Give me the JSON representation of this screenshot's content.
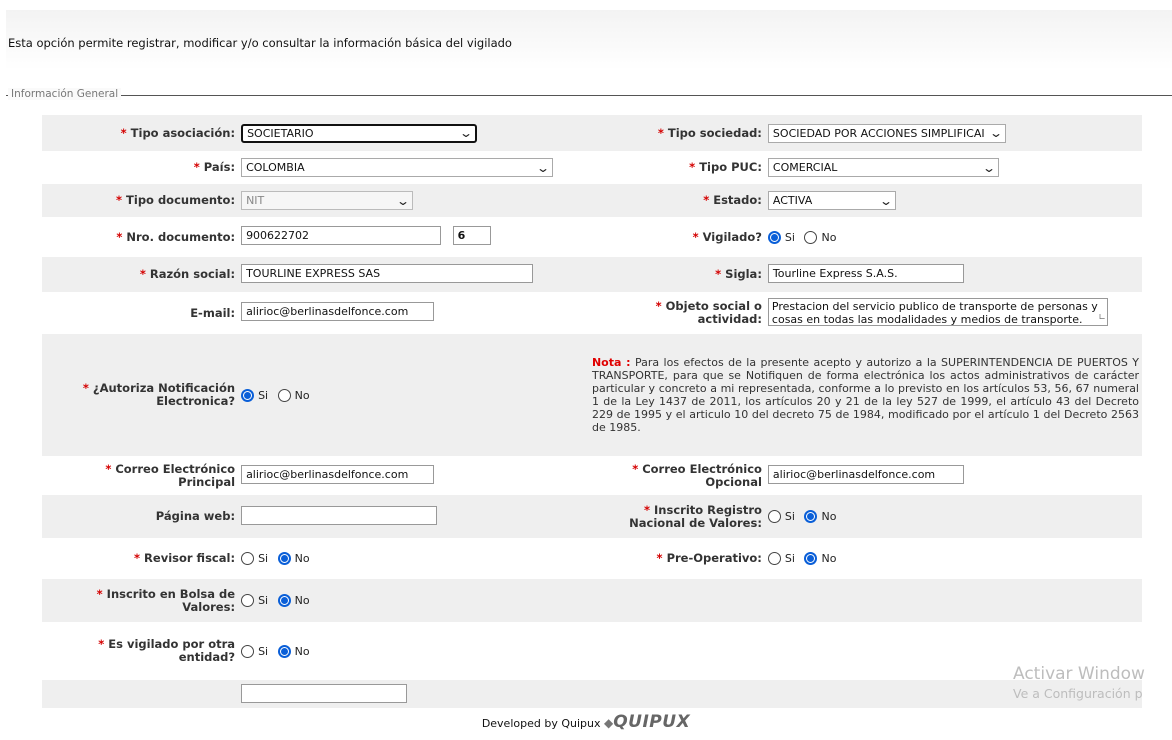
{
  "intro_text": "Esta opción permite registrar, modificar y/o consultar la información básica del vigilado",
  "legend": "Información General",
  "radio_labels": {
    "yes": "Si",
    "no": "No"
  },
  "colors": {
    "required": "#d40000",
    "radio_selected": "#0a5fd8",
    "note_label": "#e00000"
  },
  "form": {
    "tipo_asociacion": {
      "label": "Tipo asociación:",
      "value": "SOCIETARIO"
    },
    "tipo_sociedad": {
      "label": "Tipo sociedad:",
      "value": "SOCIEDAD POR ACCIONES SIMPLIFICAI"
    },
    "pais": {
      "label": "País:",
      "value": "COLOMBIA"
    },
    "tipo_puc": {
      "label": "Tipo PUC:",
      "value": "COMERCIAL"
    },
    "tipo_documento": {
      "label": "Tipo documento:",
      "value": "NIT"
    },
    "estado": {
      "label": "Estado:",
      "value": "ACTIVA"
    },
    "nro_documento": {
      "label": "Nro. documento:",
      "value": "900622702",
      "dv": "6"
    },
    "vigilado": {
      "label": "Vigilado?",
      "selected": "Si"
    },
    "razon_social": {
      "label": "Razón social:",
      "value": "TOURLINE EXPRESS SAS"
    },
    "sigla": {
      "label": "Sigla:",
      "value": "Tourline Express S.A.S."
    },
    "email": {
      "label": "E-mail:",
      "value": "alirioc@berlinasdelfonce.com"
    },
    "objeto_social": {
      "label": "Objeto social o actividad:",
      "value": "Prestacion del servicio publico de transporte de personas y cosas en todas las modalidades y medios de transporte."
    },
    "autoriza_notificacion": {
      "label": "¿Autoriza Notificación Electronica?",
      "selected": "Si"
    },
    "nota": {
      "label": "Nota :",
      "text": "Para los efectos de la presente acepto y autorizo a la SUPERINTENDENCIA DE PUERTOS Y TRANSPORTE, para que se Notifiquen de forma electrónica los actos administrativos de carácter particular y concreto a mi representada, conforme a lo previsto en los artículos 53, 56, 67 numeral 1 de la Ley 1437 de 2011, los artículos 20 y 21 de la ley 527 de 1999, el artículo 43 del Decreto 229 de 1995 y el articulo 10 del decreto 75 de 1984, modificado por el artículo 1 del Decreto 2563 de 1985."
    },
    "correo_principal": {
      "label": "Correo Electrónico Principal",
      "value": "alirioc@berlinasdelfonce.com"
    },
    "correo_opcional": {
      "label": "Correo Electrónico Opcional",
      "value": "alirioc@berlinasdelfonce.com"
    },
    "pagina_web": {
      "label": "Página web:",
      "value": ""
    },
    "registro_nacional": {
      "label": "Inscrito Registro Nacional de Valores:",
      "selected": "No"
    },
    "revisor_fiscal": {
      "label": "Revisor fiscal:",
      "selected": "No"
    },
    "pre_operativo": {
      "label": "Pre-Operativo:",
      "selected": "No"
    },
    "bolsa_valores": {
      "label": "Inscrito en Bolsa de Valores:",
      "selected": "No"
    },
    "vigilado_otra": {
      "label": "Es vigilado por otra entidad?",
      "selected": "No"
    }
  },
  "footer": {
    "text": "Developed by Quipux",
    "logo": "QUIPUX"
  },
  "watermark": {
    "line1": "Activar Window",
    "line2": "Ve a Configuración p"
  }
}
